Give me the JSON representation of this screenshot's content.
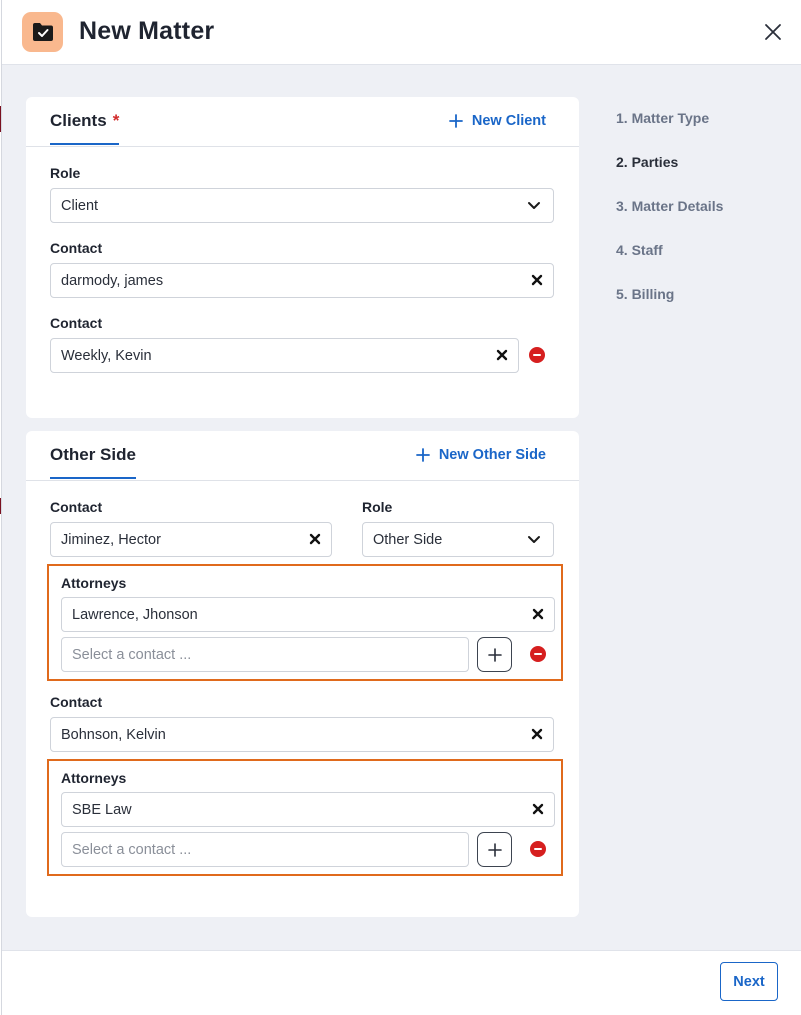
{
  "header": {
    "title": "New Matter",
    "icon": "folder-check-icon"
  },
  "clients": {
    "title": "Clients",
    "required_mark": "*",
    "new_label": "New Client",
    "role_label": "Role",
    "role_value": "Client",
    "contacts": [
      {
        "label": "Contact",
        "value": "darmody, james"
      },
      {
        "label": "Contact",
        "value": "Weekly, Kevin"
      }
    ]
  },
  "other_side": {
    "title": "Other Side",
    "new_label": "New Other Side",
    "contact_label": "Contact",
    "role_label": "Role",
    "entries": [
      {
        "contact": "Jiminez, Hector",
        "role": "Other Side",
        "attorneys_label": "Attorneys",
        "attorney": "Lawrence, Jhonson",
        "placeholder": "Select a contact ..."
      },
      {
        "contact_label": "Contact",
        "contact": "Bohnson, Kelvin",
        "attorneys_label": "Attorneys",
        "attorney": "SBE Law",
        "placeholder": "Select a contact ..."
      }
    ]
  },
  "steps": [
    "1. Matter Type",
    "2. Parties",
    "3. Matter Details",
    "4. Staff",
    "5. Billing"
  ],
  "active_step": "2. Parties",
  "footer": {
    "next_label": "Next"
  },
  "colors": {
    "accent": "#1a66c8",
    "highlight": "#e06a1c",
    "remove": "#d61f1f",
    "icon_bg": "#f9b88e"
  }
}
